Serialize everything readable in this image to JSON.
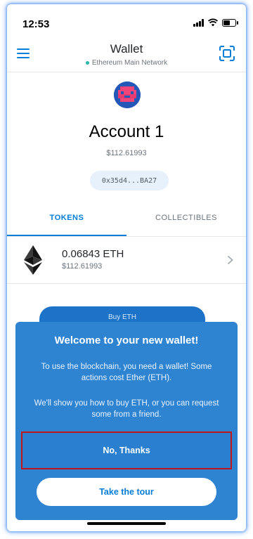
{
  "status_bar": {
    "time": "12:53"
  },
  "nav": {
    "title": "Wallet",
    "network": "Ethereum Main Network"
  },
  "account": {
    "name": "Account 1",
    "balance": "$112.61993",
    "address": "0x35d4...BA27"
  },
  "tabs": [
    {
      "label": "TOKENS",
      "selected": true
    },
    {
      "label": "COLLECTIBLES",
      "selected": false
    }
  ],
  "tokens": [
    {
      "amount": "0.06843 ETH",
      "fiat": "$112.61993",
      "icon": "ethereum-icon"
    }
  ],
  "buy_tab_label": "Buy ETH",
  "modal": {
    "title": "Welcome to your new wallet!",
    "text_1": "To use the blockchain, you need a wallet! Some actions cost Ether (ETH).",
    "text_2": "We'll show you how to buy ETH, or you can request some from a friend.",
    "no_thanks_label": "No, Thanks",
    "tour_label": "Take the tour"
  },
  "colors": {
    "accent": "#037dd6",
    "modal_bg": "#2f84d2",
    "highlight_border": "#c0141b"
  }
}
